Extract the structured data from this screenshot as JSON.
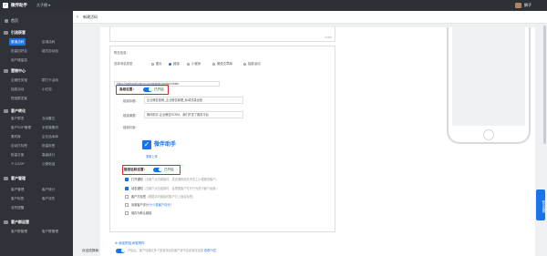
{
  "app": {
    "logo_char": "✓",
    "name": "微伴助手",
    "account": "大子德 ▾",
    "user_name": "狮子"
  },
  "sidebar": {
    "home_label": "首页",
    "sections": [
      {
        "title": "引流获客",
        "items": [
          {
            "label": "渠道活码",
            "active": true
          },
          {
            "label": "区域活码"
          },
          {
            "label": "批量加好友"
          },
          {
            "label": "链式自动加"
          },
          {
            "label": "用户增量加"
          }
        ]
      },
      {
        "title": "营销中心",
        "items": [
          {
            "label": "企微任务宝"
          },
          {
            "label": "群打卡活动"
          },
          {
            "label": "抽奖活动"
          },
          {
            "label": "小红包"
          },
          {
            "label": "短信群发客"
          }
        ]
      },
      {
        "title": "客户转化",
        "items": [
          {
            "label": "客户群发"
          },
          {
            "label": "互动雷达"
          },
          {
            "label": "客户SOP管理"
          },
          {
            "label": "手机端素材"
          },
          {
            "label": "素材库"
          },
          {
            "label": "企业话术库"
          },
          {
            "label": "自动打标签"
          },
          {
            "label": "批量标签"
          },
          {
            "label": "批量文案"
          },
          {
            "label": "高级统计"
          },
          {
            "label": "个人SOP"
          },
          {
            "label": "公费电话"
          }
        ]
      },
      {
        "title": "客户管理",
        "items": [
          {
            "label": "客户管理"
          },
          {
            "label": "客户统计"
          },
          {
            "label": "客户标签"
          },
          {
            "label": "客户流失"
          },
          {
            "label": "流失提醒"
          }
        ]
      },
      {
        "title": "客户群运营",
        "items": [
          {
            "label": "客户群管理"
          },
          {
            "label": "客户群管理"
          }
        ]
      }
    ]
  },
  "header": {
    "back_icon": "‹",
    "title": "新建活码"
  },
  "form": {
    "textarea_count": "0/400",
    "attachments_label": "附加信息：",
    "type_label": "选择消息类型",
    "types": [
      "图片",
      "链接",
      "小程序",
      "微信文章库",
      "抽奖活动"
    ],
    "selected_type": "链接",
    "url_value": "https://weibanzhushou.com/dashboard/qr/create",
    "hyperlink_toggle": {
      "label": "高级设置：",
      "state": "已开启"
    },
    "link_title_label": "链接标题：",
    "link_title_value": "企业微信营销_企业微信管理_私域流量运营",
    "link_desc_label": "链接摘要：",
    "link_desc_value": "微伴助手-企业微信SCRM，我们开发了服务平台",
    "link_cover_label": "链接封面：",
    "cover_brand": "微伴助手",
    "reupload_label": "重新上传",
    "advanced_toggle": {
      "label": "链接追踪设置：",
      "state": "已开启"
    },
    "checks": [
      {
        "on": true,
        "label": "打开通知",
        "desc": "（当客户点击链接时，发送通知给负责员工以便跟进客户）"
      },
      {
        "on": true,
        "label": "动态通知",
        "desc": "（当客户点击链接时，会根据客户打开行为进行客户画像）"
      },
      {
        "on": false,
        "label": "客户打标签",
        "desc": "（根据访问链接的客户打上指定标签）"
      },
      {
        "on": false,
        "label": "设置客户评分",
        "desc": "",
        "link": "什么是客户评分?"
      },
      {
        "on": false,
        "label": "保存为默认链接",
        "desc": ""
      }
    ],
    "add_attach_label": "添加附加消息附件",
    "welcome_label": "欢迎语屏蔽：",
    "welcome_state": "开启后，客户将通过多个渠道添加的客户将不会收到欢迎语",
    "welcome_link": "查看介绍"
  },
  "float": {
    "scan_label": "联系客服"
  }
}
